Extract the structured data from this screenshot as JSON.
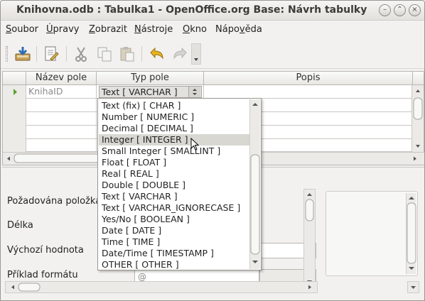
{
  "window": {
    "title": "Knihovna.odb : Tabulka1 - OpenOffice.org Base: Návrh tabulky",
    "minimize_icon": "minimize-icon",
    "maximize_icon": "maximize-icon",
    "close_icon": "close-icon"
  },
  "menu": [
    {
      "accel": "S",
      "rest": "oubor"
    },
    {
      "accel": "Ú",
      "rest": "pravy"
    },
    {
      "accel": "Z",
      "rest": "obrazit"
    },
    {
      "accel": "N",
      "rest": "ástroje"
    },
    {
      "accel": "O",
      "rest": "kno"
    },
    {
      "accel": "",
      "pre": "Nápo",
      "accel2": "v",
      "post": "ěda"
    }
  ],
  "toolbar": {
    "icons": [
      "save-icon",
      "edit-icon",
      "cut-icon",
      "copy-icon",
      "paste-icon",
      "undo-icon",
      "redo-icon",
      "overflow-arrow-icon"
    ]
  },
  "grid": {
    "columns": [
      "Název pole",
      "Typ pole",
      "Popis"
    ],
    "rows": [
      {
        "name": "KnihaID",
        "type": "Text [ VARCHAR ]",
        "description": ""
      }
    ]
  },
  "type_dropdown": {
    "options": [
      "Text (fix) [ CHAR ]",
      "Number [ NUMERIC ]",
      "Decimal [ DECIMAL ]",
      "Integer [ INTEGER ]",
      "Small Integer [ SMALLINT ]",
      "Float [ FLOAT ]",
      "Real [ REAL ]",
      "Double [ DOUBLE ]",
      "Text [ VARCHAR ]",
      "Text [ VARCHAR_IGNORECASE ]",
      "Yes/No [ BOOLEAN ]",
      "Date [ DATE ]",
      "Time [ TIME ]",
      "Date/Time [ TIMESTAMP ]",
      "OTHER [ OTHER ]"
    ],
    "highlighted": "Integer [ INTEGER ]"
  },
  "properties": {
    "labels": [
      "Požadována položka",
      "Délka",
      "Výchozí hodnota",
      "Příklad formátu"
    ],
    "format_example_value": "@"
  }
}
